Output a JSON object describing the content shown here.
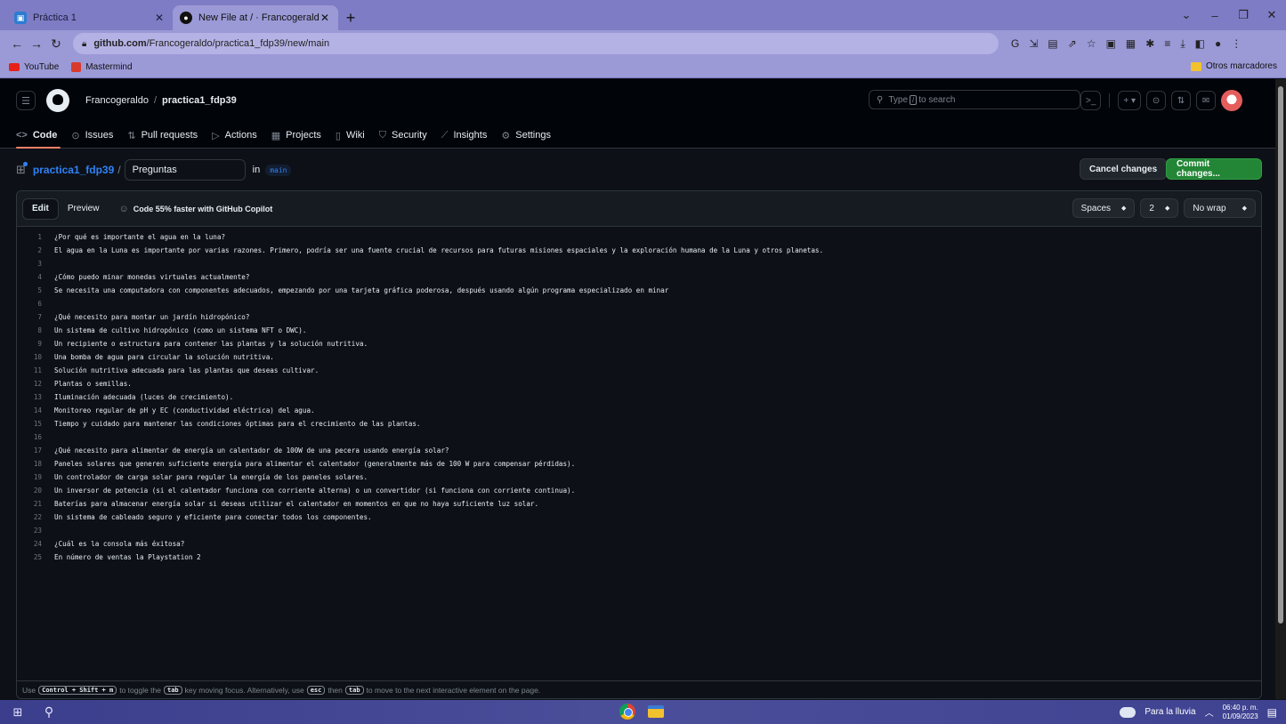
{
  "browser": {
    "tabs": [
      {
        "title": "Práctica 1",
        "active": false
      },
      {
        "title": "New File at / · Francogeraldo/pra",
        "active": true
      }
    ],
    "url_host": "github.com",
    "url_path": "/Francogeraldo/practica1_fdp39/new/main",
    "bookmarks": [
      {
        "label": "YouTube",
        "color": "#e62117"
      },
      {
        "label": "Mastermind",
        "color": "#d93a2b"
      }
    ],
    "other_bookmarks": "Otros marcadores"
  },
  "github": {
    "owner": "Francogeraldo",
    "repo": "practica1_fdp39",
    "search_placeholder_pre": "Type",
    "search_key": "/",
    "search_placeholder_post": "to search",
    "nav_tabs": [
      {
        "label": "Code",
        "icon": "<>"
      },
      {
        "label": "Issues",
        "icon": "⊙"
      },
      {
        "label": "Pull requests",
        "icon": "⇅"
      },
      {
        "label": "Actions",
        "icon": "▷"
      },
      {
        "label": "Projects",
        "icon": "▦"
      },
      {
        "label": "Wiki",
        "icon": "▯"
      },
      {
        "label": "Security",
        "icon": "⛉"
      },
      {
        "label": "Insights",
        "icon": "⟋"
      },
      {
        "label": "Settings",
        "icon": "⚙"
      }
    ]
  },
  "file": {
    "repo_link": "practica1_fdp39",
    "separator": "/",
    "filename": "Preguntas",
    "in_label": "in",
    "branch": "main",
    "cancel_label": "Cancel changes",
    "commit_label": "Commit changes..."
  },
  "editor": {
    "edit_label": "Edit",
    "preview_label": "Preview",
    "copilot_label": "Code 55% faster with GitHub Copilot",
    "indent_mode": "Spaces",
    "indent_size": "2",
    "wrap_mode": "No wrap",
    "lines": [
      "¿Por qué es importante el agua en la luna?",
      "El agua en la Luna es importante por varias razones. Primero, podría ser una fuente crucial de recursos para futuras misiones espaciales y la exploración humana de la Luna y otros planetas.",
      "",
      "¿Cómo puedo minar monedas virtuales actualmente?",
      "Se necesita una computadora con componentes adecuados, empezando por una tarjeta gráfica poderosa, después usando algún programa especializado en minar",
      "",
      "¿Qué necesito para montar un jardín hidropónico?",
      "Un sistema de cultivo hidropónico (como un sistema NFT o DWC).",
      "Un recipiente o estructura para contener las plantas y la solución nutritiva.",
      "Una bomba de agua para circular la solución nutritiva.",
      "Solución nutritiva adecuada para las plantas que deseas cultivar.",
      "Plantas o semillas.",
      "Iluminación adecuada (luces de crecimiento).",
      "Monitoreo regular de pH y EC (conductividad eléctrica) del agua.",
      "Tiempo y cuidado para mantener las condiciones óptimas para el crecimiento de las plantas.",
      "",
      "¿Qué necesito para alimentar de energía un calentador de 100W de una pecera usando energía solar?",
      "Paneles solares que generen suficiente energía para alimentar el calentador (generalmente más de 100 W para compensar pérdidas).",
      "Un controlador de carga solar para regular la energía de los paneles solares.",
      "Un inversor de potencia (si el calentador funciona con corriente alterna) o un convertidor (si funciona con corriente continua).",
      "Baterías para almacenar energía solar si deseas utilizar el calentador en momentos en que no haya suficiente luz solar.",
      "Un sistema de cableado seguro y eficiente para conectar todos los componentes.",
      "",
      "¿Cuál es la consola más éxitosa?",
      "En número de ventas la Playstation 2"
    ],
    "footer": {
      "t1": "Use",
      "k1": "Control + Shift + m",
      "t2": "to toggle the",
      "k2": "tab",
      "t3": "key moving focus. Alternatively, use",
      "k3": "esc",
      "t4": "then",
      "k4": "tab",
      "t5": "to move to the next interactive element on the page."
    }
  },
  "taskbar": {
    "weather": "Para la lluvia",
    "time": "06:40 p. m.",
    "date": "01/09/2023"
  }
}
